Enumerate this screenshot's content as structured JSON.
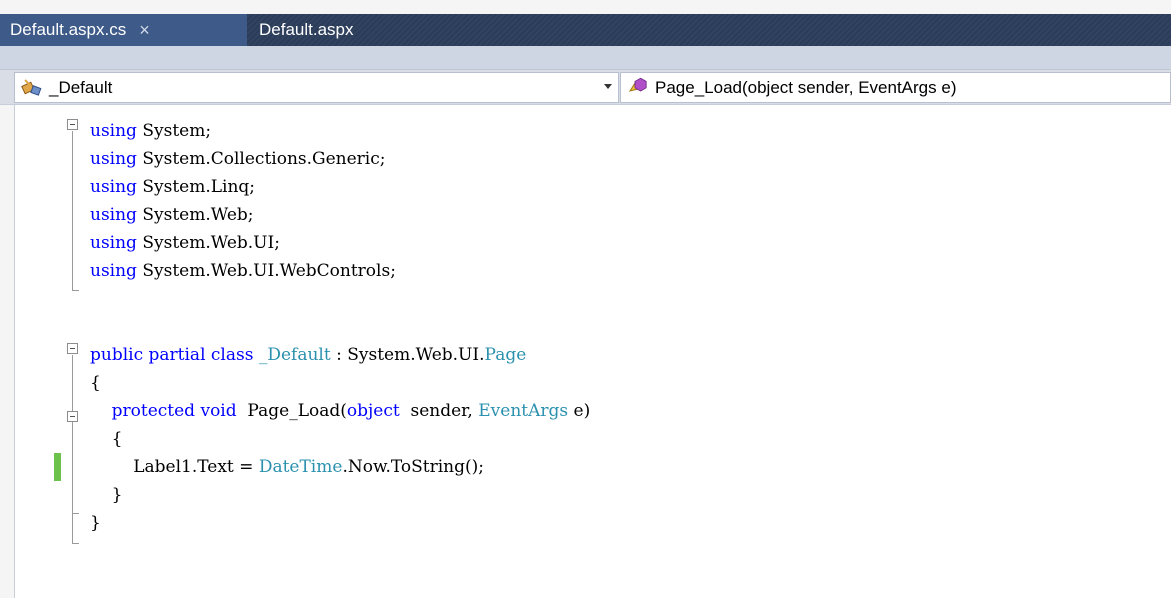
{
  "tabs": [
    {
      "label": "Default.aspx.cs",
      "active": true,
      "close_glyph": "×"
    },
    {
      "label": "Default.aspx",
      "active": false
    }
  ],
  "navbar": {
    "class_combo": {
      "label": "_Default",
      "icon": "class-icon"
    },
    "member_combo": {
      "label": "Page_Load(object sender, EventArgs e)",
      "icon": "method-icon"
    }
  },
  "code": [
    {
      "tokens": [
        [
          "kw",
          "using"
        ],
        [
          "",
          "System;"
        ]
      ]
    },
    {
      "tokens": [
        [
          "kw",
          "using"
        ],
        [
          "",
          "System.Collections.Generic;"
        ]
      ]
    },
    {
      "tokens": [
        [
          "kw",
          "using"
        ],
        [
          "",
          "System.Linq;"
        ]
      ]
    },
    {
      "tokens": [
        [
          "kw",
          "using"
        ],
        [
          "",
          "System.Web;"
        ]
      ]
    },
    {
      "tokens": [
        [
          "kw",
          "using"
        ],
        [
          "",
          "System.Web.UI;"
        ]
      ]
    },
    {
      "tokens": [
        [
          "kw",
          "using"
        ],
        [
          "",
          "System.Web.UI.WebControls;"
        ]
      ]
    },
    {
      "tokens": []
    },
    {
      "tokens": [
        [
          "kw",
          "public"
        ],
        [
          "",
          ""
        ],
        [
          "kw",
          "partial"
        ],
        [
          "",
          ""
        ],
        [
          "kw",
          "class"
        ],
        [
          "",
          ""
        ],
        [
          "tp",
          "_Default"
        ],
        [
          "",
          " : System.Web.UI."
        ],
        [
          "tp",
          "Page"
        ]
      ]
    },
    {
      "tokens": [
        [
          "",
          "{"
        ]
      ]
    },
    {
      "tokens": [
        [
          "",
          "    "
        ],
        [
          "kw",
          "protected"
        ],
        [
          "",
          ""
        ],
        [
          "kw",
          "void"
        ],
        [
          "",
          " Page_Load("
        ],
        [
          "kw",
          "object"
        ],
        [
          "",
          " sender, "
        ],
        [
          "tp",
          "EventArgs"
        ],
        [
          "",
          " e)"
        ]
      ]
    },
    {
      "tokens": [
        [
          "",
          "    {"
        ]
      ]
    },
    {
      "tokens": [
        [
          "",
          "        Label1.Text = "
        ],
        [
          "tp",
          "DateTime"
        ],
        [
          "",
          ".Now.ToString();"
        ]
      ]
    },
    {
      "tokens": [
        [
          "",
          "    }"
        ]
      ]
    },
    {
      "tokens": [
        [
          "",
          "}"
        ]
      ]
    }
  ],
  "colors": {
    "keyword": "#0000ff",
    "type": "#2b91af",
    "changed_marker": "#6cc24a",
    "tab_active": "#3d5a88",
    "tab_strip": "#2b3c5a"
  }
}
